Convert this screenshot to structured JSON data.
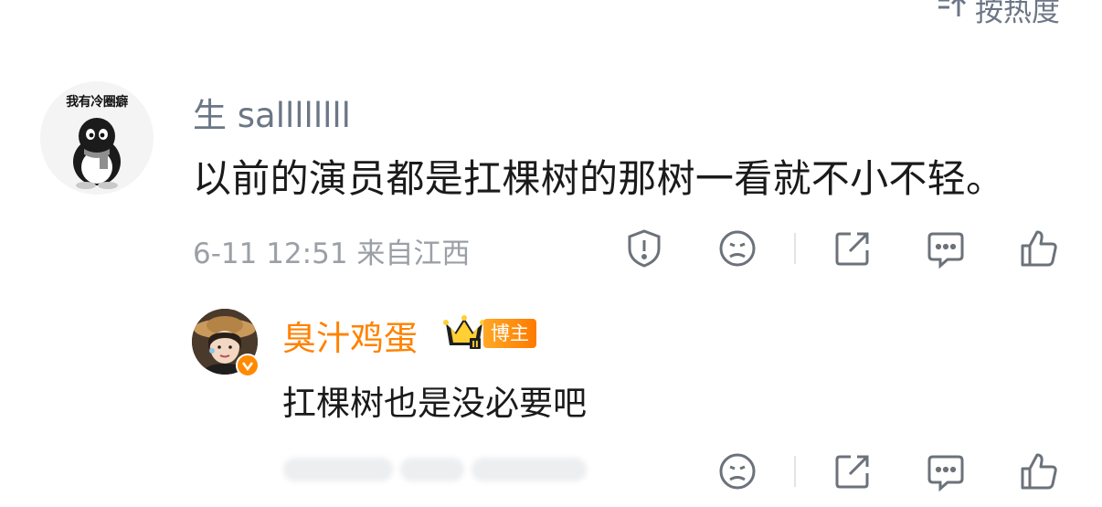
{
  "sort": {
    "icon": "sort-icon",
    "label": "按热度"
  },
  "comment": {
    "avatar_text": "我有冷圈癖",
    "username": "生 sallllllll",
    "text": "以前的演员都是扛棵树的那树一看就不小不轻。",
    "time": "6-11 12:51",
    "location": "来自江西",
    "actions": [
      "report-icon",
      "dislike-icon",
      "share-icon",
      "comment-icon",
      "like-icon"
    ]
  },
  "reply": {
    "username": "臭汁鸡蛋",
    "crown_level": "II",
    "badge": "博主",
    "text": "扛棵树也是没必要吧",
    "actions": [
      "dislike-icon",
      "share-icon",
      "comment-icon",
      "like-icon"
    ]
  },
  "colors": {
    "accent_orange": "#ff8200",
    "muted_text": "#9b9fa6",
    "username_gray": "#6b7686"
  }
}
